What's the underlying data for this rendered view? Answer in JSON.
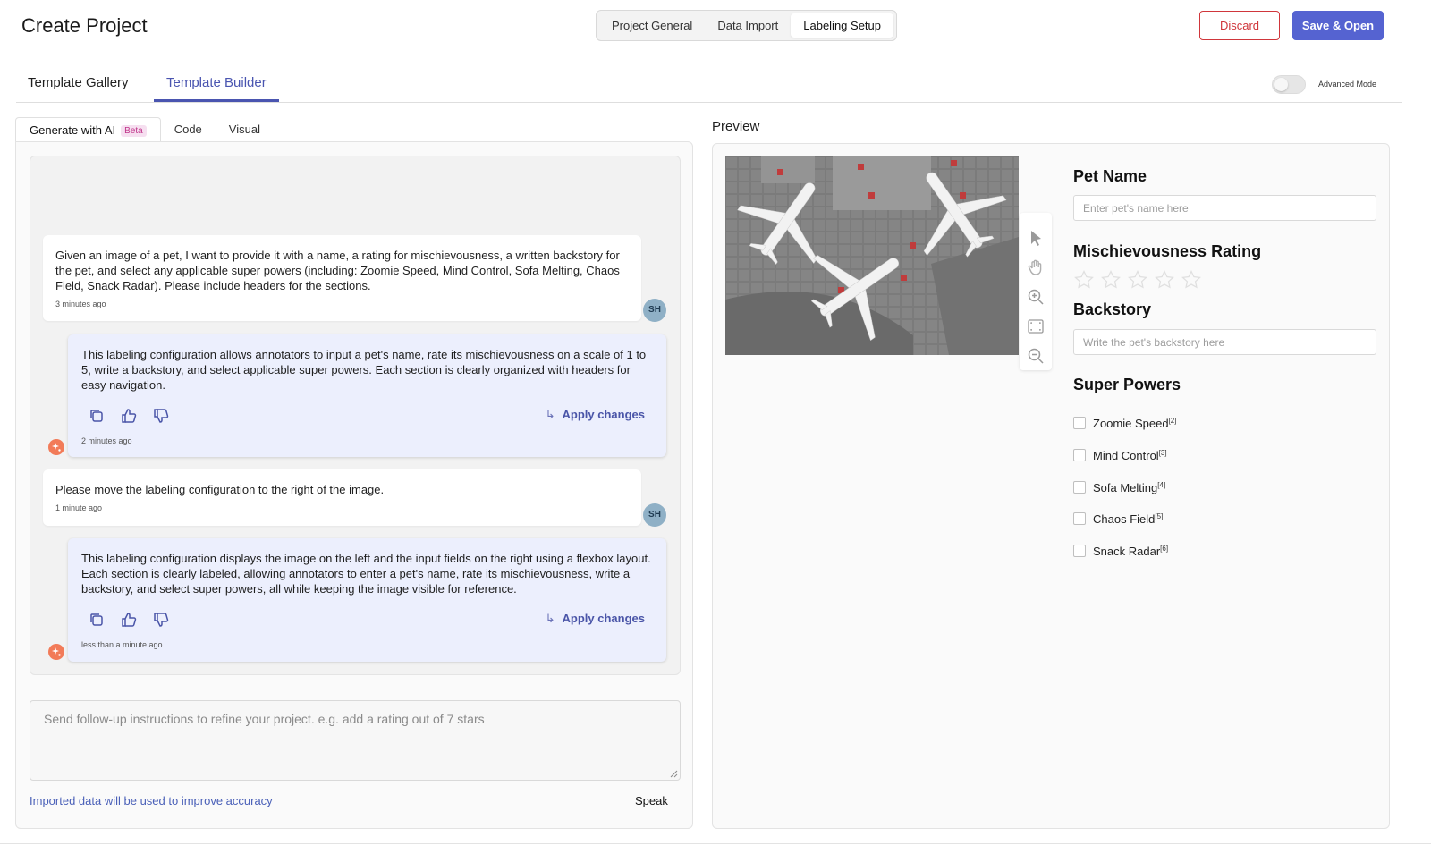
{
  "header": {
    "title": "Create Project",
    "steps": [
      "Project General",
      "Data Import",
      "Labeling Setup"
    ],
    "active_step": "Labeling Setup",
    "discard_label": "Discard",
    "save_label": "Save & Open"
  },
  "template_tabs": {
    "gallery": "Template Gallery",
    "builder": "Template Builder",
    "advanced_mode": "Advanced Mode"
  },
  "editor_tabs": {
    "ai": "Generate with AI",
    "beta": "Beta",
    "code": "Code",
    "visual": "Visual"
  },
  "chat": {
    "messages": [
      {
        "from": "user",
        "avatar": "SH",
        "text": "Given an image of a pet, I want to provide it with a name, a rating for mischievousness, a written backstory for the pet, and select any applicable super powers (including: Zoomie Speed, Mind Control, Sofa Melting, Chaos Field, Snack Radar). Please include headers for the sections.",
        "time": "3 minutes ago"
      },
      {
        "from": "ai",
        "text": "This labeling configuration allows annotators to input a pet's name, rate its mischievousness on a scale of 1 to 5, write a backstory, and select applicable super powers. Each section is clearly organized with headers for easy navigation.",
        "time": "2 minutes ago",
        "apply_label": "Apply changes"
      },
      {
        "from": "user",
        "avatar": "SH",
        "text": "Please move the labeling configuration to the right of the image.",
        "time": "1 minute ago"
      },
      {
        "from": "ai",
        "text": "This labeling configuration displays the image on the left and the input fields on the right using a flexbox layout. Each section is clearly labeled, allowing annotators to enter a pet's name, rate its mischievousness, write a backstory, and select super powers, all while keeping the image visible for reference.",
        "time": "less than a minute ago",
        "apply_label": "Apply changes"
      }
    ],
    "input_placeholder": "Send follow-up instructions to refine your project. e.g. add a rating out of 7 stars",
    "imported_note": "Imported data will be used to improve accuracy",
    "speak_label": "Speak"
  },
  "preview": {
    "label": "Preview",
    "pet_name_header": "Pet Name",
    "pet_name_placeholder": "Enter pet's name here",
    "rating_header": "Mischievousness Rating",
    "rating_max": 5,
    "rating_value": 0,
    "backstory_header": "Backstory",
    "backstory_placeholder": "Write the pet's backstory here",
    "powers_header": "Super Powers",
    "powers": [
      {
        "label": "Zoomie Speed",
        "hotkey": "[2]"
      },
      {
        "label": "Mind Control",
        "hotkey": "[3]"
      },
      {
        "label": "Sofa Melting",
        "hotkey": "[4]"
      },
      {
        "label": "Chaos Field",
        "hotkey": "[5]"
      },
      {
        "label": "Snack Radar",
        "hotkey": "[6]"
      }
    ],
    "tools": [
      "pointer-icon",
      "hand-icon",
      "zoom-in-icon",
      "fit-icon",
      "zoom-out-icon"
    ]
  },
  "colors": {
    "accent": "#5563d1",
    "discard": "#d0363b",
    "ai_bubble": "#eceffd",
    "ai_badge": "#f27b58"
  }
}
